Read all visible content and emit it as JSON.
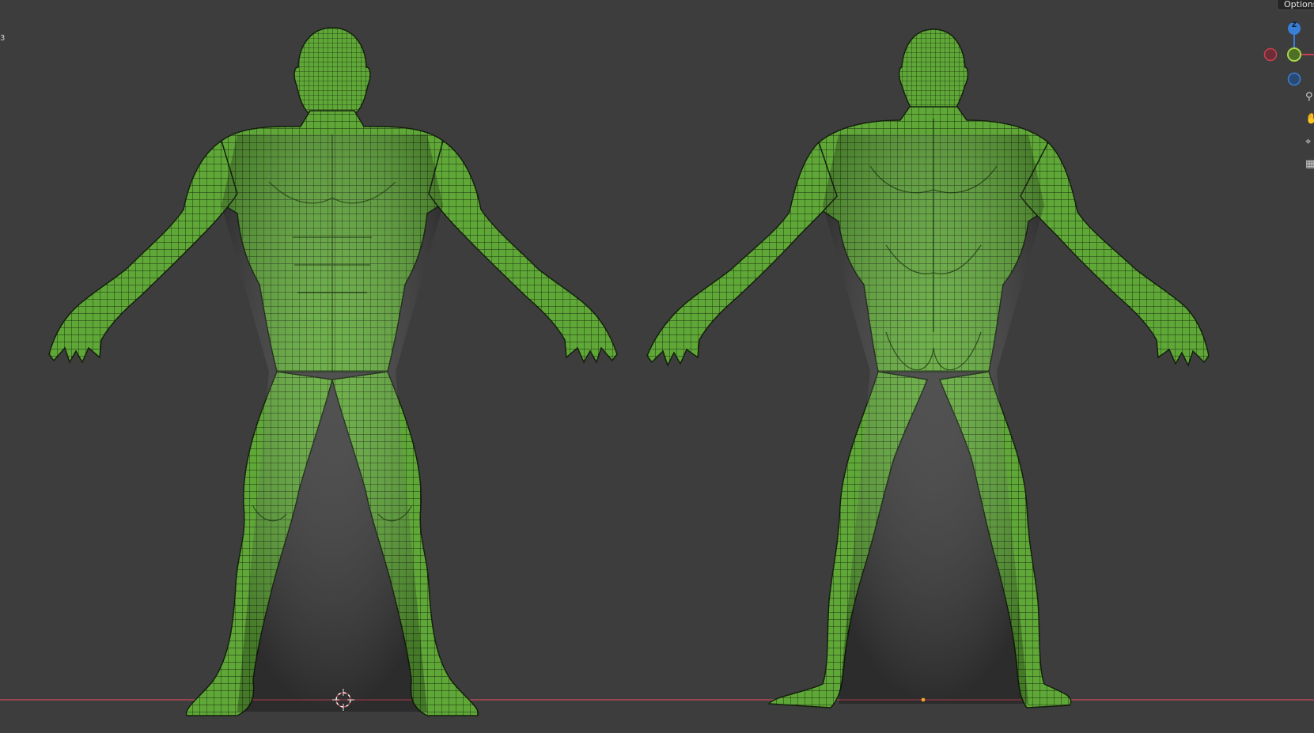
{
  "viewport": {
    "frame_label": "3",
    "options_label": "Options",
    "gizmo": {
      "z_label": "Z"
    },
    "colors": {
      "background": "#3d3d3d",
      "mesh_fill": "#5fa838",
      "mesh_wire": "#1b2b10",
      "x_axis": "#c94150",
      "y_axis": "#86c13b",
      "z_axis": "#3a7fd6",
      "origin_dot": "#f0a030"
    },
    "objects": [
      {
        "name": "body-front-view",
        "view": "front"
      },
      {
        "name": "body-back-view",
        "view": "back"
      }
    ],
    "nav_tools": [
      "zoom-icon",
      "hand-pan-icon",
      "camera-icon",
      "grid-toggle-icon"
    ]
  }
}
